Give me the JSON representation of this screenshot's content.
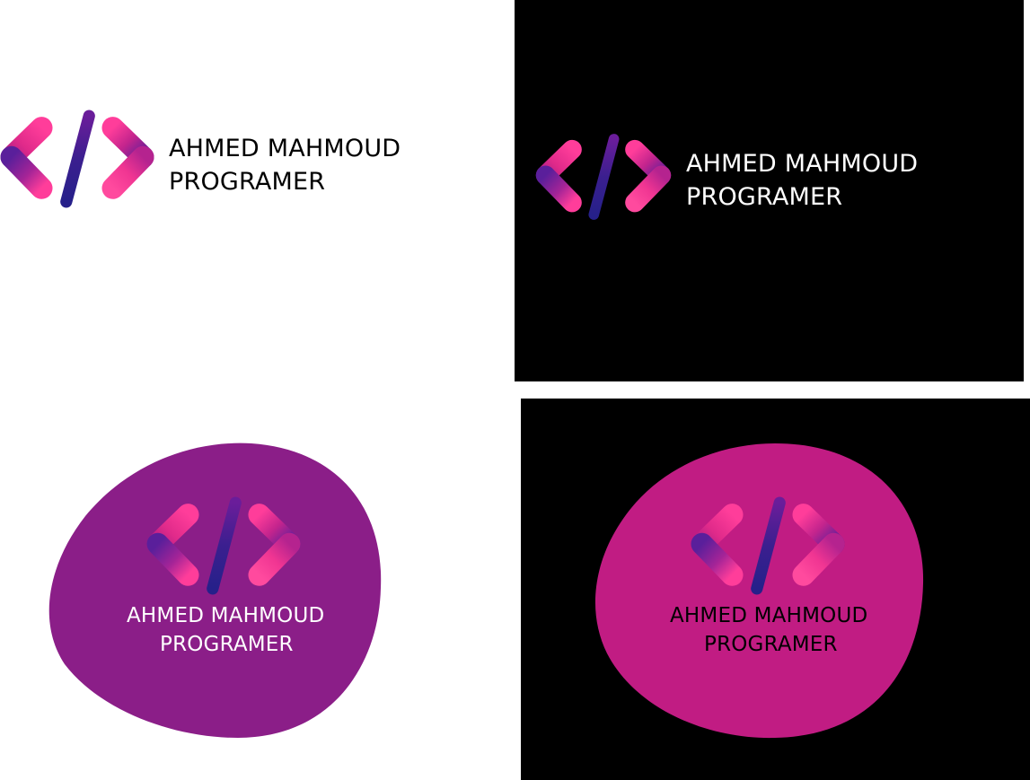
{
  "brand": {
    "line1": "AHMED MAHMOUD",
    "line2": "PROGRAMER"
  },
  "variants": [
    {
      "background": "#ffffff",
      "shape": "none",
      "shape_color": "",
      "text_color": "#000000"
    },
    {
      "background": "#000000",
      "shape": "none",
      "shape_color": "",
      "text_color": "#ffffff"
    },
    {
      "background": "#ffffff",
      "shape": "blob",
      "shape_color": "#8b1e88",
      "text_color": "#ffffff"
    },
    {
      "background": "#000000",
      "shape": "blob",
      "shape_color": "#c11c83",
      "text_color": "#000000"
    }
  ],
  "colors": {
    "pink": "#ec2f8c",
    "purple": "#6a1d9a",
    "navy": "#2b1c7e"
  },
  "icons": [
    "code-brackets-logo-icon"
  ]
}
